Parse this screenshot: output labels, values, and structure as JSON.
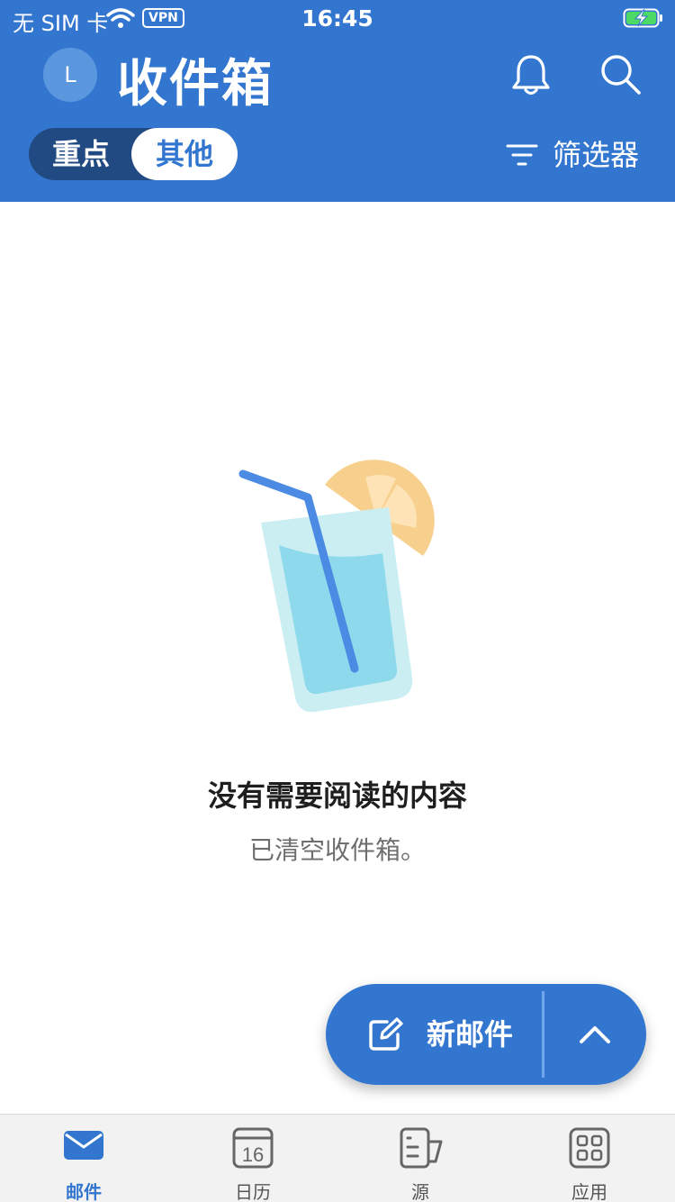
{
  "status_bar": {
    "carrier": "无 SIM 卡",
    "vpn": "VPN",
    "time": "16:45"
  },
  "header": {
    "avatar_initial": "L",
    "title": "收件箱",
    "segment": {
      "focused_label": "重点",
      "other_label": "其他",
      "selected": "其他"
    },
    "filter_label": "筛选器"
  },
  "empty_state": {
    "title": "没有需要阅读的内容",
    "subtitle": "已清空收件箱。"
  },
  "fab": {
    "compose_label": "新邮件"
  },
  "tab_bar": {
    "items": [
      {
        "label": "邮件",
        "icon": "mail-icon",
        "active": true
      },
      {
        "label": "日历",
        "icon": "calendar-icon",
        "calendar_day": "16",
        "active": false
      },
      {
        "label": "源",
        "icon": "feed-icon",
        "active": false
      },
      {
        "label": "应用",
        "icon": "apps-icon",
        "active": false
      }
    ]
  },
  "colors": {
    "brand_blue": "#3276CF",
    "segment_dark": "#214A83",
    "tab_bar_bg": "#F2F2F2"
  }
}
